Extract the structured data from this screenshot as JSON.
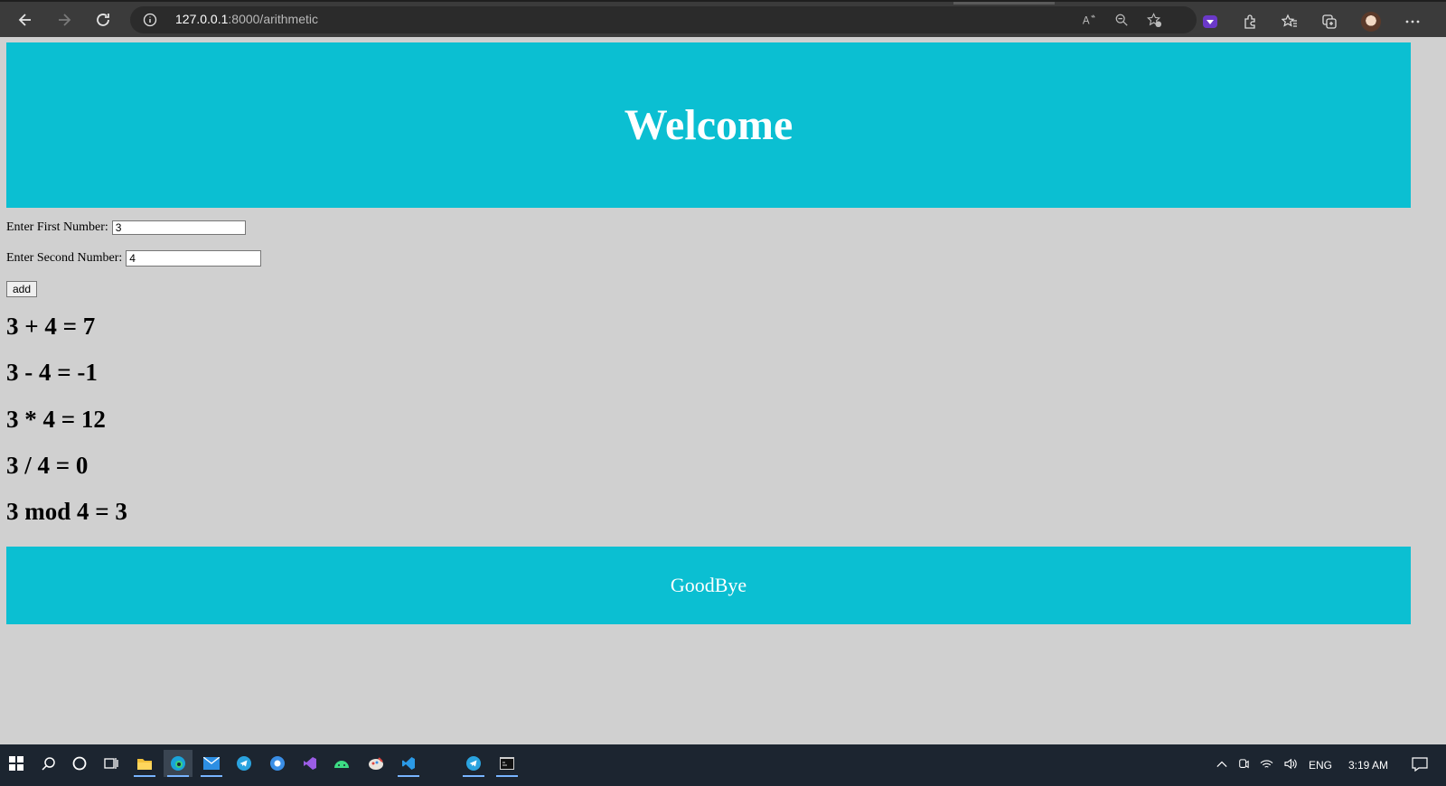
{
  "browser": {
    "url_host": "127.0.0.1",
    "url_rest": ":8000/arithmetic"
  },
  "page": {
    "header_title": "Welcome",
    "first_label": "Enter First Number:",
    "first_value": "3",
    "second_label": "Enter Second Number:",
    "second_value": "4",
    "add_label": "add",
    "results": [
      "3 + 4 = 7",
      "3 - 4 = -1",
      "3 * 4 = 12",
      "3 / 4 = 0",
      "3 mod 4 = 3"
    ],
    "footer_text": "GoodBye",
    "accent_color": "#0bbfd2",
    "background_color": "#d0d0d0"
  },
  "taskbar": {
    "language": "ENG",
    "time": "3:19 AM"
  }
}
